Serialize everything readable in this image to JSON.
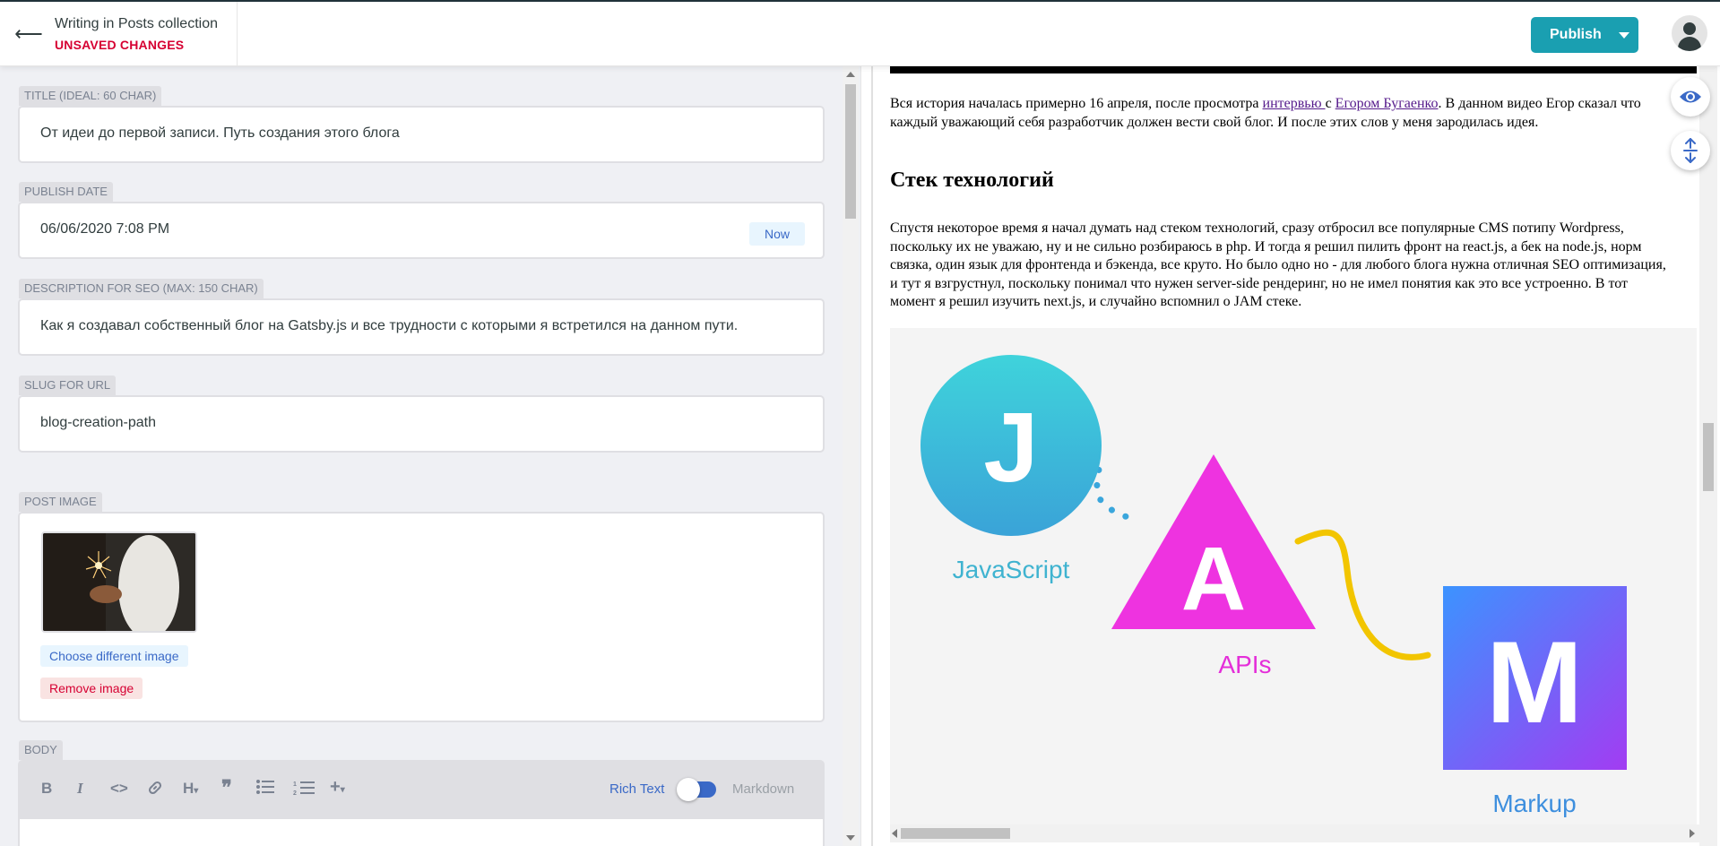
{
  "header": {
    "back_icon": "arrow-left-icon",
    "collection_title": "Writing in Posts collection",
    "status": "UNSAVED CHANGES",
    "publish_label": "Publish"
  },
  "fields": {
    "title": {
      "label": "TITLE (IDEAL: 60 CHAR)",
      "value": "От идеи до первой записи. Путь создания этого блога"
    },
    "publish_date": {
      "label": "PUBLISH DATE",
      "value": "06/06/2020 7:08 PM",
      "now_label": "Now"
    },
    "description": {
      "label": "DESCRIPTION FOR SEO (MAX: 150 CHAR)",
      "value": "Как я создавал собственный блог на Gatsby.js и все трудности с которыми я встретился на данном пути."
    },
    "slug": {
      "label": "SLUG FOR URL",
      "value": "blog-creation-path"
    },
    "post_image": {
      "label": "POST IMAGE",
      "choose_label": "Choose different image",
      "remove_label": "Remove image"
    },
    "body": {
      "label": "BODY",
      "rich_text_label": "Rich Text",
      "markdown_label": "Markdown",
      "toolbar_icons": [
        "bold-icon",
        "italic-icon",
        "code-icon",
        "link-icon",
        "heading-icon",
        "quote-icon",
        "bulleted-list-icon",
        "numbered-list-icon",
        "add-icon"
      ]
    }
  },
  "preview": {
    "intro_part1": "Вся история началась примерно 16 апреля, после просмотра ",
    "intro_link1": "интервью ",
    "intro_part2": "с ",
    "intro_link2": "Егором Бугаенко",
    "intro_part3": ". В данном видео Егор сказал что каждый уважающий себя разработчик должен вести свой блог. И после этих слов у меня зародилась идея.",
    "heading": "Стек технологий",
    "paragraph": "Спустя некоторое время я начал думать над стеком технологий, сразу отбросил все популярные CMS потипу Wordpress, поскольку их не уважаю, ну и не сильно розбираюсь в php. И тогда я решил пилить фронт на react.js, а бек на node.js, норм связка, один язык для фронтенда и бэкенда, все круто. Но было одно но - для любого блога нужна отличная SEO оптимизация, и тут я взгрустнул, поскольку понимал что нужен server-side рендеринг, но не имел понятия как это все устроенно. В тот момент я решил изучить next.js, и случайно вспомнил о JAM стеке.",
    "jam": {
      "j_letter": "J",
      "j_caption": "JavaScript",
      "a_letter": "A",
      "a_caption": "APIs",
      "m_letter": "M",
      "m_caption": "Markup"
    }
  },
  "side_buttons": {
    "preview_icon": "eye-icon",
    "sync_scroll_icon": "sync-scroll-icon"
  }
}
